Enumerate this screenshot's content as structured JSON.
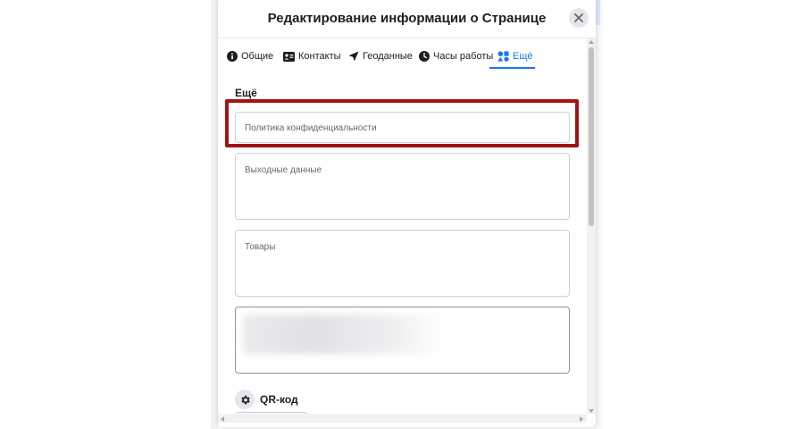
{
  "dialog": {
    "title": "Редактирование информации о Странице",
    "close_icon": "close-icon"
  },
  "tabs": [
    {
      "label": "Общие",
      "icon": "info-icon"
    },
    {
      "label": "Контакты",
      "icon": "contact-card-icon"
    },
    {
      "label": "Геоданные",
      "icon": "location-arrow-icon"
    },
    {
      "label": "Часы работы",
      "icon": "clock-icon"
    },
    {
      "label": "Ещё",
      "icon": "people-shapes-icon",
      "active": true
    }
  ],
  "section": {
    "heading": "Ещё"
  },
  "fields": {
    "privacy_policy": {
      "placeholder": "Политика конфиденциальности"
    },
    "imprint": {
      "placeholder": "Выходные данные"
    },
    "products": {
      "placeholder": "Товары"
    }
  },
  "qr": {
    "label": "QR-код",
    "icon": "gear-icon"
  },
  "colors": {
    "accent": "#1877f2",
    "highlight": "#a31313"
  }
}
